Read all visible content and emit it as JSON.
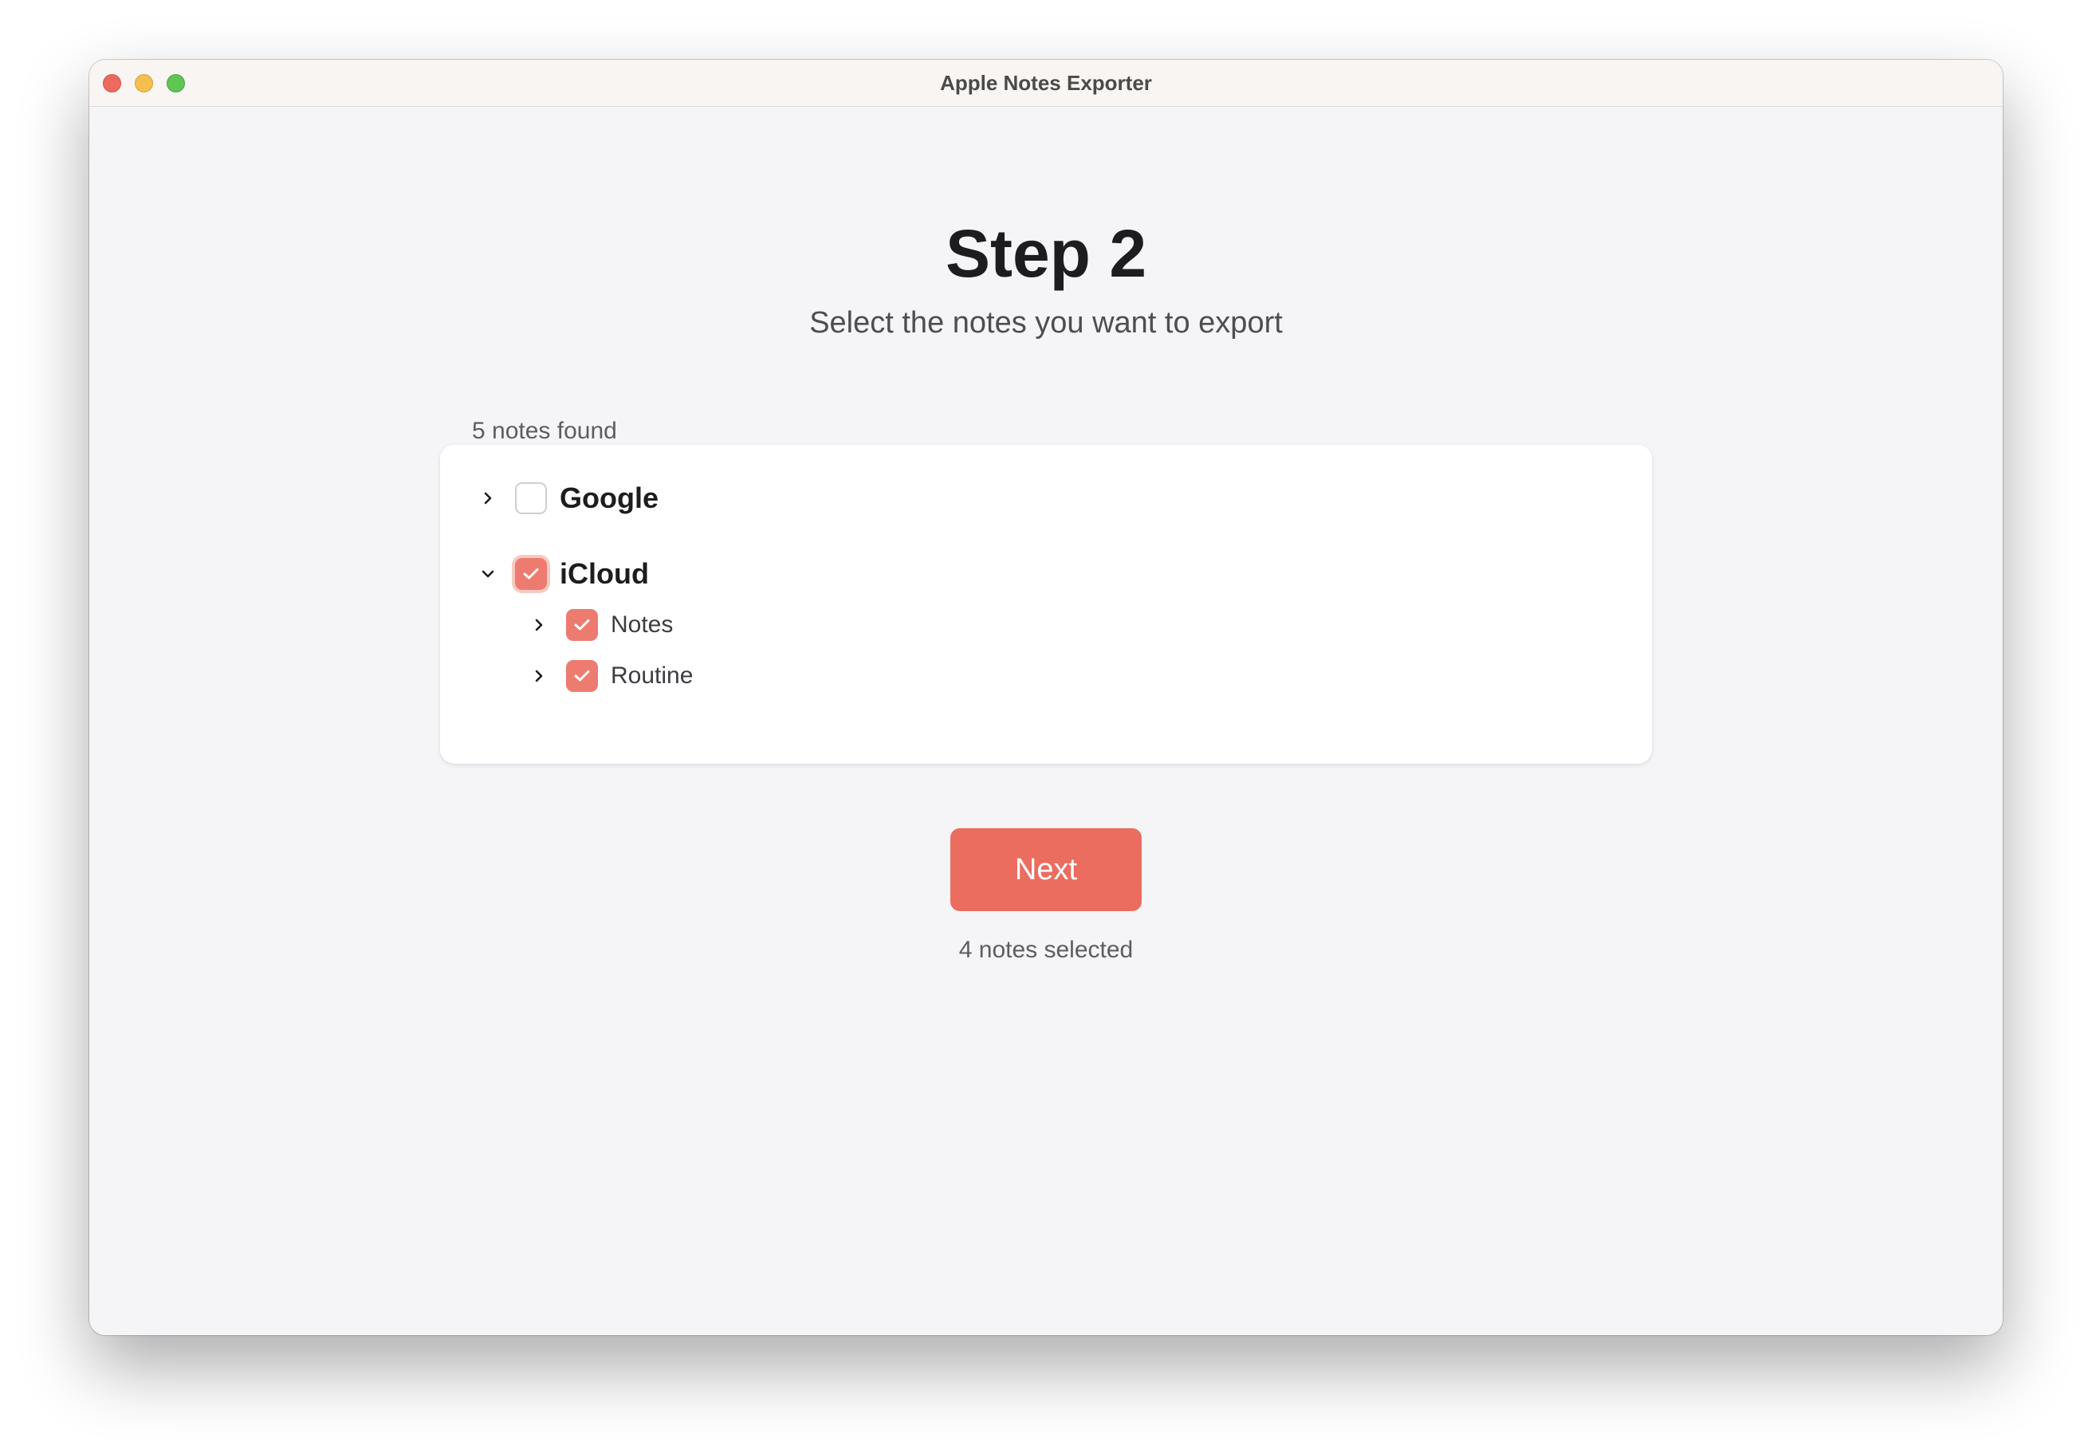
{
  "window": {
    "title": "Apple Notes Exporter"
  },
  "header": {
    "title": "Step 2",
    "subtitle": "Select the notes you want to export"
  },
  "tree": {
    "count_label": "5 notes found",
    "items": [
      {
        "label": "Google",
        "checked": false,
        "expanded": false
      },
      {
        "label": "iCloud",
        "checked": true,
        "expanded": true,
        "children": [
          {
            "label": "Notes",
            "checked": true,
            "expanded": false
          },
          {
            "label": "Routine",
            "checked": true,
            "expanded": false
          }
        ]
      }
    ]
  },
  "footer": {
    "next_label": "Next",
    "selected_label": "4 notes selected"
  },
  "colors": {
    "accent": "#ea6d60",
    "checkbox_checked": "#ed7b6f",
    "background": "#f5f4f7"
  },
  "icons": {
    "collapsed": "chevron-right-icon",
    "expanded": "chevron-down-icon",
    "check": "checkmark-icon"
  }
}
